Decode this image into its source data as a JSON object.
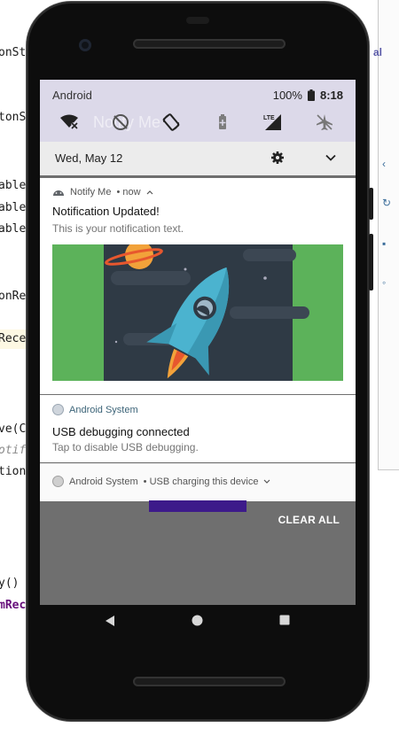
{
  "ide": {
    "lines": [
      "onSt",
      "tonS",
      "able",
      "able",
      "able",
      "onRe",
      "Rece",
      "ve(C",
      "otif",
      "tion(",
      "y()",
      "mRec"
    ],
    "right_fragment": "al"
  },
  "status_bar": {
    "carrier": "Android",
    "battery": "100%",
    "time": "8:18"
  },
  "quick_settings": {
    "ghost_title": "Notify Me",
    "tiles": [
      "wifi-off-icon",
      "do-not-disturb-icon",
      "auto-rotate-icon",
      "battery-saver-icon",
      "lte-signal-icon",
      "airplane-mode-icon"
    ],
    "date": "Wed, May 12"
  },
  "notifications": [
    {
      "app": "Notify Me",
      "meta": "• now",
      "title": "Notification Updated!",
      "text": "This is your notification text.",
      "picture": "rocket-illustration"
    },
    {
      "app": "Android System",
      "title": "USB debugging connected",
      "text": "Tap to disable USB debugging."
    },
    {
      "app": "Android System",
      "summary": "• USB charging this device"
    }
  ],
  "clear_all_label": "CLEAR ALL",
  "colors": {
    "quick_settings_bg": "#dcd9e9",
    "picture_green": "#5cb25a",
    "picture_dark": "#2f3a45",
    "rocket_blue": "#4bb3cf",
    "accent_purple": "#3d1a8a",
    "scrim": "#6f6f6f"
  }
}
